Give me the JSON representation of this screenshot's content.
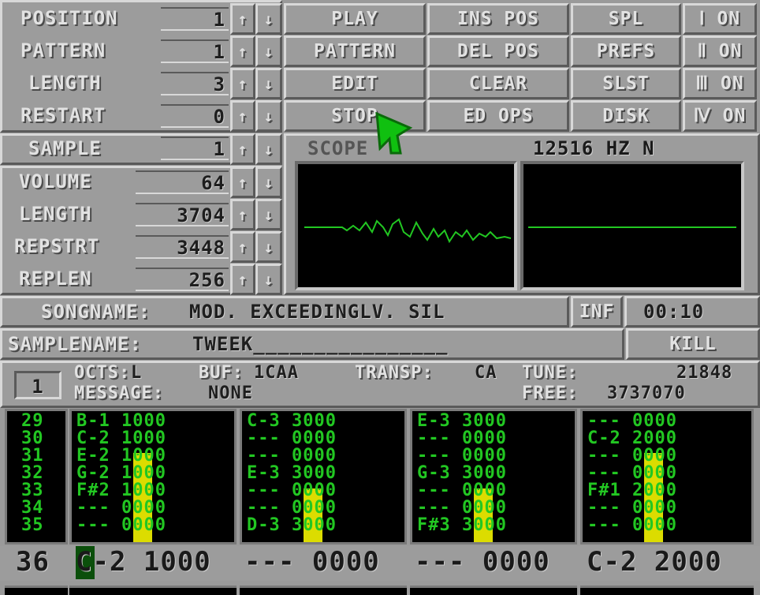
{
  "controls": {
    "position": {
      "label": "POSITION",
      "value": "1"
    },
    "pattern": {
      "label": "PATTERN",
      "value": "1"
    },
    "length": {
      "label": "LENGTH",
      "value": "3"
    },
    "restart": {
      "label": "RESTART",
      "value": "0"
    },
    "sample": {
      "label": "SAMPLE",
      "value": "1"
    },
    "volume": {
      "label": "VOLUME",
      "value": "64"
    },
    "samplength": {
      "label": "LENGTH",
      "value": "3704"
    },
    "repstrt": {
      "label": "REPSTRT",
      "value": "3448"
    },
    "replen": {
      "label": "REPLEN",
      "value": "256"
    },
    "up_glyph": "↑",
    "down_glyph": "↓"
  },
  "buttons": {
    "play": "PLAY",
    "pattern": "PATTERN",
    "edit": "EDIT",
    "stop": "STOP",
    "ins_pos": "INS POS",
    "del_pos": "DEL POS",
    "clear": "CLEAR",
    "ed_ops": "ED OPS",
    "spl": "SPL",
    "prefs": "PREFS",
    "slst": "SLST",
    "disk": "DISK",
    "ch1": "Ⅰ ON",
    "ch2": "Ⅱ ON",
    "ch3": "Ⅲ ON",
    "ch4": "Ⅳ ON"
  },
  "scope": {
    "label": "SCOPE",
    "freq": "12516 HZ N"
  },
  "song": {
    "label": "SONGNAME:",
    "name": "MOD. EXCEEDINGLV. SIL",
    "inf": "INF",
    "time": "00:10"
  },
  "sampname": {
    "label": "SAMPLENAME:",
    "name": "TWEEK________________",
    "kill": "KILL"
  },
  "info": {
    "channel": "1",
    "octs_label": "OCTS:",
    "octs": "L",
    "buf_label": "BUF:",
    "buf": "1CAA",
    "transp_label": "TRANSP:",
    "transp": "CA",
    "tune_label": "TUNE:",
    "tune": "21848",
    "message_label": "MESSAGE:",
    "message": "NONE",
    "free_label": "FREE:",
    "free": "3737070"
  },
  "rownums": [
    "29",
    "30",
    "31",
    "32",
    "33",
    "34",
    "35"
  ],
  "tracks": [
    {
      "rows": [
        "B-1 1000",
        "C-2 1000",
        "E-2 1000",
        "G-2 1000",
        "F#2 1000",
        "--- 0000",
        "--- 0000"
      ],
      "vu": 0.68
    },
    {
      "rows": [
        "C-3 3000",
        "--- 0000",
        "--- 0000",
        "E-3 3000",
        "--- 0000",
        "--- 0000",
        "D-3 3000"
      ],
      "vu": 0.41
    },
    {
      "rows": [
        "E-3 3000",
        "--- 0000",
        "--- 0000",
        "G-3 3000",
        "--- 0000",
        "--- 0000",
        "F#3 3000"
      ],
      "vu": 0.41
    },
    {
      "rows": [
        "--- 0000",
        "C-2 2000",
        "--- 0000",
        "--- 0000",
        "F#1 2000",
        "--- 0000",
        "--- 0000"
      ],
      "vu": 0.68
    }
  ],
  "current": {
    "row": "36",
    "tracks": [
      "C-2 1000",
      "--- 0000",
      "--- 0000",
      "C-2 2000"
    ]
  },
  "colors": {
    "panel": "#9c9c9c",
    "highlight": "#d8d8d8",
    "shadow": "#5a5a5a",
    "note": "#22c722",
    "vu": "#dcdc00",
    "cursor": "#00c000"
  }
}
